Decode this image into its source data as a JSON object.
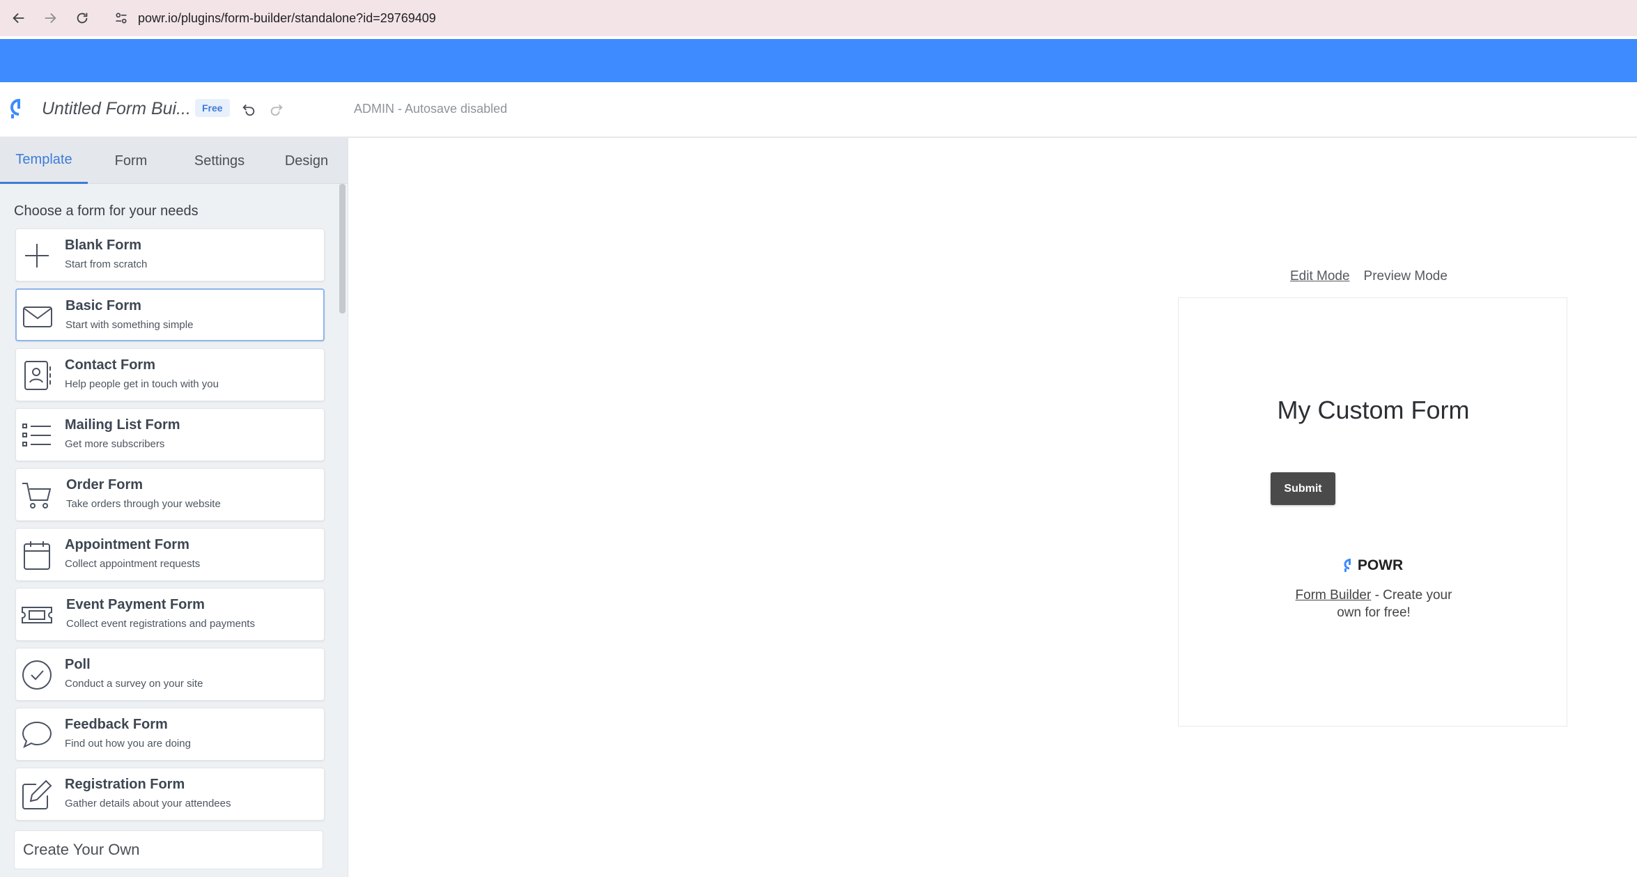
{
  "browser": {
    "url": "powr.io/plugins/form-builder/standalone?id=29769409"
  },
  "header": {
    "title": "Untitled Form Bui...",
    "badge": "Free",
    "autosave": "ADMIN - Autosave disabled"
  },
  "sidebar": {
    "tabs": [
      {
        "label": "Template",
        "active": true
      },
      {
        "label": "Form",
        "active": false
      },
      {
        "label": "Settings",
        "active": false
      },
      {
        "label": "Design",
        "active": false
      }
    ],
    "choose_label": "Choose a form for your needs",
    "templates": [
      {
        "title": "Blank Form",
        "sub": "Start from scratch",
        "icon": "plus-icon"
      },
      {
        "title": "Basic Form",
        "sub": "Start with something simple",
        "icon": "envelope-icon",
        "selected": true
      },
      {
        "title": "Contact Form",
        "sub": "Help people get in touch with you",
        "icon": "contact-book-icon"
      },
      {
        "title": "Mailing List Form",
        "sub": "Get more subscribers",
        "icon": "list-icon"
      },
      {
        "title": "Order Form",
        "sub": "Take orders through your website",
        "icon": "cart-icon"
      },
      {
        "title": "Appointment Form",
        "sub": "Collect appointment requests",
        "icon": "calendar-icon"
      },
      {
        "title": "Event Payment Form",
        "sub": "Collect event registrations and payments",
        "icon": "ticket-icon"
      },
      {
        "title": "Poll",
        "sub": "Conduct a survey on your site",
        "icon": "check-circle-icon"
      },
      {
        "title": "Feedback Form",
        "sub": "Find out how you are doing",
        "icon": "speech-bubble-icon"
      },
      {
        "title": "Registration Form",
        "sub": "Gather details about your attendees",
        "icon": "edit-icon"
      }
    ],
    "create_own": "Create Your Own"
  },
  "preview": {
    "edit_mode": "Edit Mode",
    "preview_mode": "Preview Mode",
    "form_title": "My Custom Form",
    "submit_label": "Submit",
    "brand": "POWR",
    "tagline_link": "Form Builder",
    "tagline_rest": " - Create your own for free!"
  },
  "colors": {
    "accent": "#3d8bff",
    "tab_active": "#3d7bd9",
    "submit_bg": "#4a4a4a"
  }
}
